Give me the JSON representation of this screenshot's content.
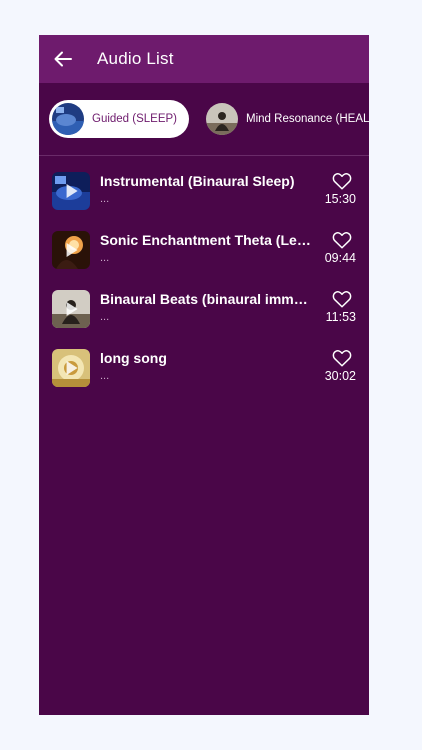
{
  "app_bar": {
    "title": "Audio List",
    "back_icon": "arrow-left-icon"
  },
  "categories": [
    {
      "label": "Guided (SLEEP)",
      "selected": true
    },
    {
      "label": "Mind Resonance (HEAL)",
      "selected": false
    }
  ],
  "tracks": [
    {
      "title": "Instrumental (Binaural Sleep)",
      "subtitle": "...",
      "duration": "15:30",
      "favorite_icon": "heart-outline-icon"
    },
    {
      "title": "Sonic Enchantment Theta (Lev...",
      "subtitle": "...",
      "duration": "09:44",
      "favorite_icon": "heart-outline-icon"
    },
    {
      "title": "Binaural Beats (binaural imme...",
      "subtitle": "...",
      "duration": "11:53",
      "favorite_icon": "heart-outline-icon"
    },
    {
      "title": "long song",
      "subtitle": "...",
      "duration": "30:02",
      "favorite_icon": "heart-outline-icon"
    }
  ],
  "colors": {
    "app_bar": "#6e1b6d",
    "background": "#4a0648",
    "page_background": "#f4f7fe",
    "text_primary": "#ffffff"
  }
}
